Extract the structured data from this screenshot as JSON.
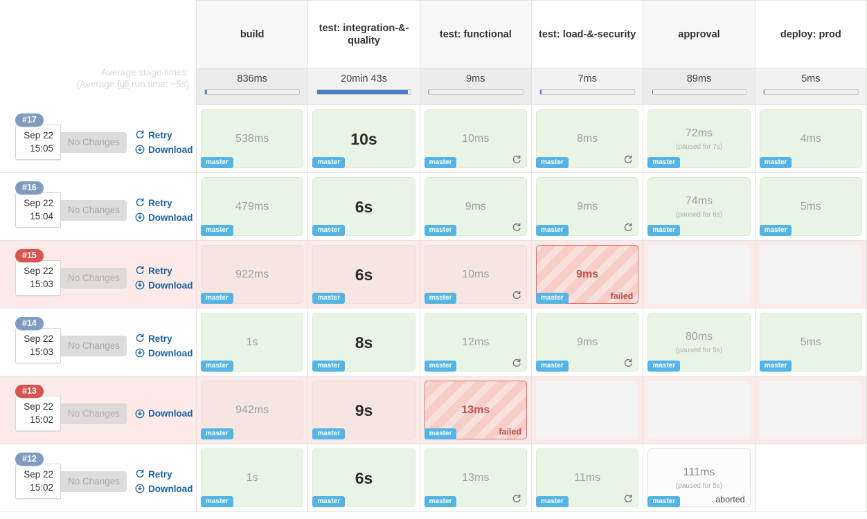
{
  "summary": {
    "line1": "Average stage times:",
    "line2_pre": "(Average ",
    "line2_underline": "full",
    "line2_post": " run time: ~5s)"
  },
  "colors": {
    "success_bg": "#e9f5e4",
    "failed_bg": "#f7cdc8",
    "failed_border": "#dd6b63",
    "branch_badge": "#55b4e3",
    "badge_ok": "#7f9cc0",
    "badge_fail": "#d9534f",
    "link": "#1d5f9e",
    "progress_fill": "#4a80c4"
  },
  "stages": [
    {
      "name": "build",
      "avg": "836ms",
      "bar_pct": 2
    },
    {
      "name": "test: integration-&-quality",
      "avg": "20min 43s",
      "bar_pct": 97
    },
    {
      "name": "test: functional",
      "avg": "9ms",
      "bar_pct": 1
    },
    {
      "name": "test: load-&-security",
      "avg": "7ms",
      "bar_pct": 1
    },
    {
      "name": "approval",
      "avg": "89ms",
      "bar_pct": 1
    },
    {
      "name": "deploy: prod",
      "avg": "5ms",
      "bar_pct": 1
    }
  ],
  "row_actions": {
    "retry_label": "Retry",
    "download_label": "Download",
    "nochanges_label": "No Changes"
  },
  "labels": {
    "branch": "master",
    "failed": "failed",
    "aborted": "aborted"
  },
  "runs": [
    {
      "id": "#17",
      "date": "Sep 22",
      "time": "15:05",
      "state": "ok",
      "has_retry": true,
      "has_download": true,
      "cells": [
        {
          "state": "success",
          "time": "538ms",
          "big": false,
          "branch": "master",
          "retry_icon": false
        },
        {
          "state": "success",
          "time": "10s",
          "big": true,
          "branch": "master",
          "retry_icon": false
        },
        {
          "state": "success",
          "time": "10ms",
          "big": false,
          "branch": "master",
          "retry_icon": true
        },
        {
          "state": "success",
          "time": "8ms",
          "big": false,
          "branch": "master",
          "retry_icon": true
        },
        {
          "state": "success",
          "time": "72ms",
          "big": false,
          "branch": "master",
          "sub": "(paused for 7s)",
          "retry_icon": false
        },
        {
          "state": "success",
          "time": "4ms",
          "big": false,
          "branch": "master",
          "retry_icon": false
        }
      ]
    },
    {
      "id": "#16",
      "date": "Sep 22",
      "time": "15:04",
      "state": "ok",
      "has_retry": true,
      "has_download": true,
      "cells": [
        {
          "state": "success",
          "time": "479ms",
          "big": false,
          "branch": "master",
          "retry_icon": false
        },
        {
          "state": "success",
          "time": "6s",
          "big": true,
          "branch": "master",
          "retry_icon": false
        },
        {
          "state": "success",
          "time": "9ms",
          "big": false,
          "branch": "master",
          "retry_icon": true
        },
        {
          "state": "success",
          "time": "9ms",
          "big": false,
          "branch": "master",
          "retry_icon": true
        },
        {
          "state": "success",
          "time": "74ms",
          "big": false,
          "branch": "master",
          "sub": "(paused for 6s)",
          "retry_icon": false
        },
        {
          "state": "success",
          "time": "5ms",
          "big": false,
          "branch": "master",
          "retry_icon": false
        }
      ]
    },
    {
      "id": "#15",
      "date": "Sep 22",
      "time": "15:03",
      "state": "failed",
      "has_retry": true,
      "has_download": true,
      "cells": [
        {
          "state": "success",
          "time": "922ms",
          "big": false,
          "branch": "master",
          "retry_icon": false
        },
        {
          "state": "success",
          "time": "6s",
          "big": true,
          "branch": "master",
          "retry_icon": false
        },
        {
          "state": "success",
          "time": "10ms",
          "big": false,
          "branch": "master",
          "retry_icon": true
        },
        {
          "state": "failed",
          "time": "9ms",
          "big": false,
          "branch": "master",
          "status": "failed",
          "retry_icon": false
        },
        {
          "state": "empty"
        },
        {
          "state": "empty"
        }
      ]
    },
    {
      "id": "#14",
      "date": "Sep 22",
      "time": "15:03",
      "state": "ok",
      "has_retry": true,
      "has_download": true,
      "cells": [
        {
          "state": "success",
          "time": "1s",
          "big": false,
          "branch": "master",
          "retry_icon": false
        },
        {
          "state": "success",
          "time": "8s",
          "big": true,
          "branch": "master",
          "retry_icon": false
        },
        {
          "state": "success",
          "time": "12ms",
          "big": false,
          "branch": "master",
          "retry_icon": true
        },
        {
          "state": "success",
          "time": "9ms",
          "big": false,
          "branch": "master",
          "retry_icon": true
        },
        {
          "state": "success",
          "time": "80ms",
          "big": false,
          "branch": "master",
          "sub": "(paused for 5s)",
          "retry_icon": false
        },
        {
          "state": "success",
          "time": "5ms",
          "big": false,
          "branch": "master",
          "retry_icon": false
        }
      ]
    },
    {
      "id": "#13",
      "date": "Sep 22",
      "time": "15:02",
      "state": "failed",
      "has_retry": false,
      "has_download": true,
      "cells": [
        {
          "state": "success",
          "time": "942ms",
          "big": false,
          "branch": "master",
          "retry_icon": false
        },
        {
          "state": "success",
          "time": "9s",
          "big": true,
          "branch": "master",
          "retry_icon": false
        },
        {
          "state": "failed",
          "time": "13ms",
          "big": false,
          "branch": "master",
          "status": "failed",
          "retry_icon": false
        },
        {
          "state": "empty"
        },
        {
          "state": "empty"
        },
        {
          "state": "empty"
        }
      ]
    },
    {
      "id": "#12",
      "date": "Sep 22",
      "time": "15:02",
      "state": "ok",
      "has_retry": true,
      "has_download": true,
      "cells": [
        {
          "state": "success",
          "time": "1s",
          "big": false,
          "branch": "master",
          "retry_icon": false
        },
        {
          "state": "success",
          "time": "6s",
          "big": true,
          "branch": "master",
          "retry_icon": false
        },
        {
          "state": "success",
          "time": "13ms",
          "big": false,
          "branch": "master",
          "retry_icon": true
        },
        {
          "state": "success",
          "time": "11ms",
          "big": false,
          "branch": "master",
          "retry_icon": true
        },
        {
          "state": "aborted",
          "time": "111ms",
          "big": false,
          "branch": "master",
          "sub": "(paused for 5s)",
          "status": "aborted",
          "retry_icon": false
        },
        {
          "state": "empty"
        }
      ]
    }
  ]
}
